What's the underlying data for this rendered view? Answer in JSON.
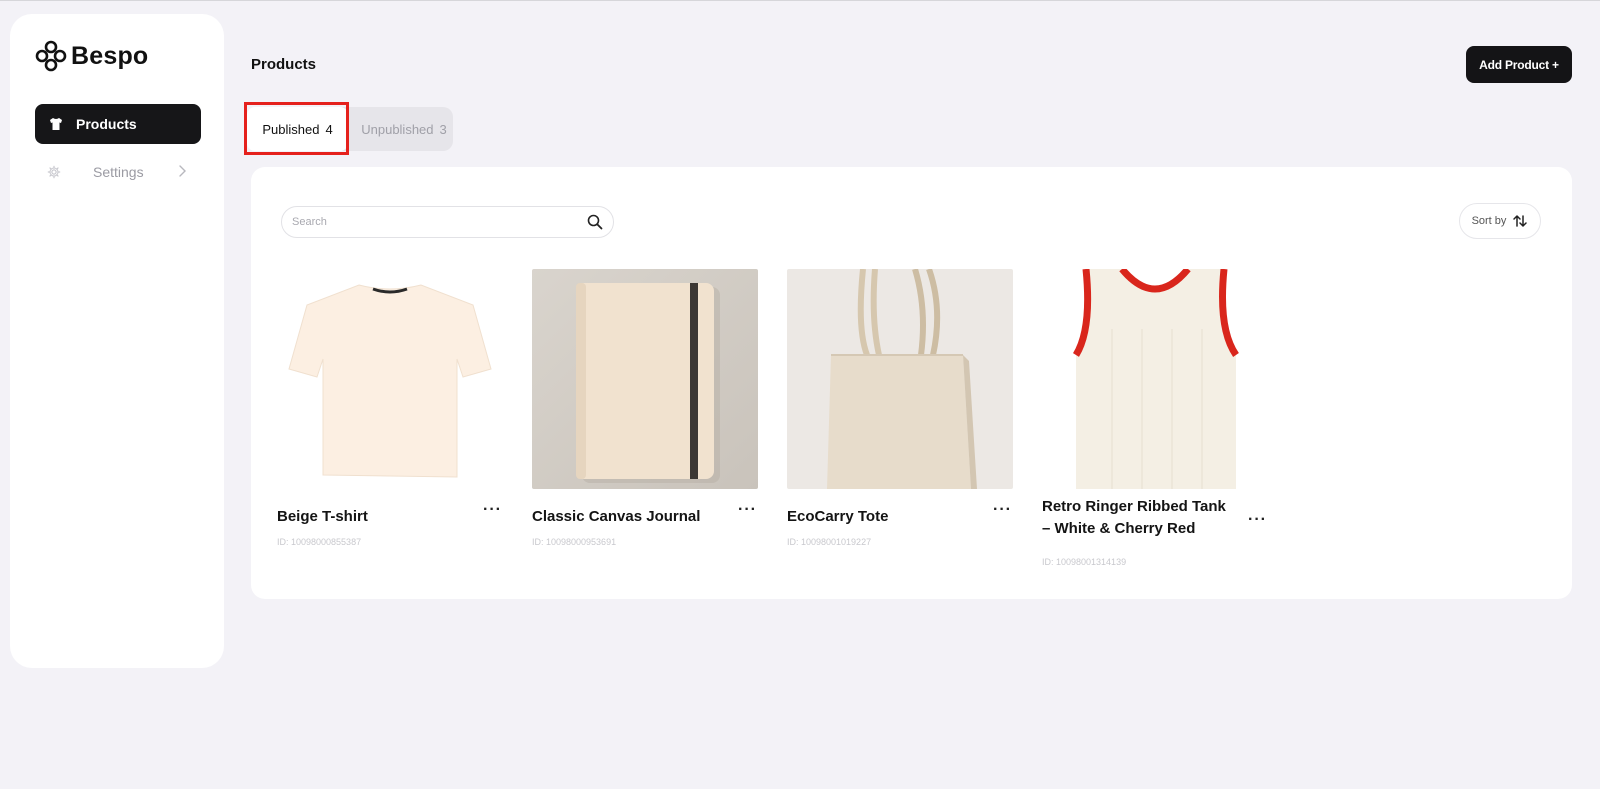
{
  "brand": {
    "name": "Bespo"
  },
  "sidebar": {
    "items": [
      {
        "label": "Products",
        "active": true,
        "icon": "tshirt-icon"
      },
      {
        "label": "Settings",
        "active": false,
        "icon": "gear-icon"
      }
    ]
  },
  "header": {
    "title": "Products",
    "add_button": "Add Product +"
  },
  "tabs": [
    {
      "label": "Published",
      "count": "4",
      "selected": true
    },
    {
      "label": "Unpublished",
      "count": "3",
      "selected": false
    }
  ],
  "toolbar": {
    "search_placeholder": "Search",
    "sort_label": "Sort by"
  },
  "products": [
    {
      "name": "Beige T-shirt",
      "id": "ID: 10098000855387",
      "image": "beige-tshirt"
    },
    {
      "name": "Classic Canvas Journal",
      "id": "ID: 10098000953691",
      "image": "canvas-journal"
    },
    {
      "name": "EcoCarry Tote",
      "id": "ID: 10098001019227",
      "image": "tote-bag"
    },
    {
      "name": "Retro Ringer Ribbed Tank – White & Cherry Red",
      "id": "ID: 10098001314139",
      "image": "ringer-tank"
    }
  ],
  "colors": {
    "accent": "#141416",
    "highlight": "#e5211d",
    "background": "#f3f2f7"
  }
}
